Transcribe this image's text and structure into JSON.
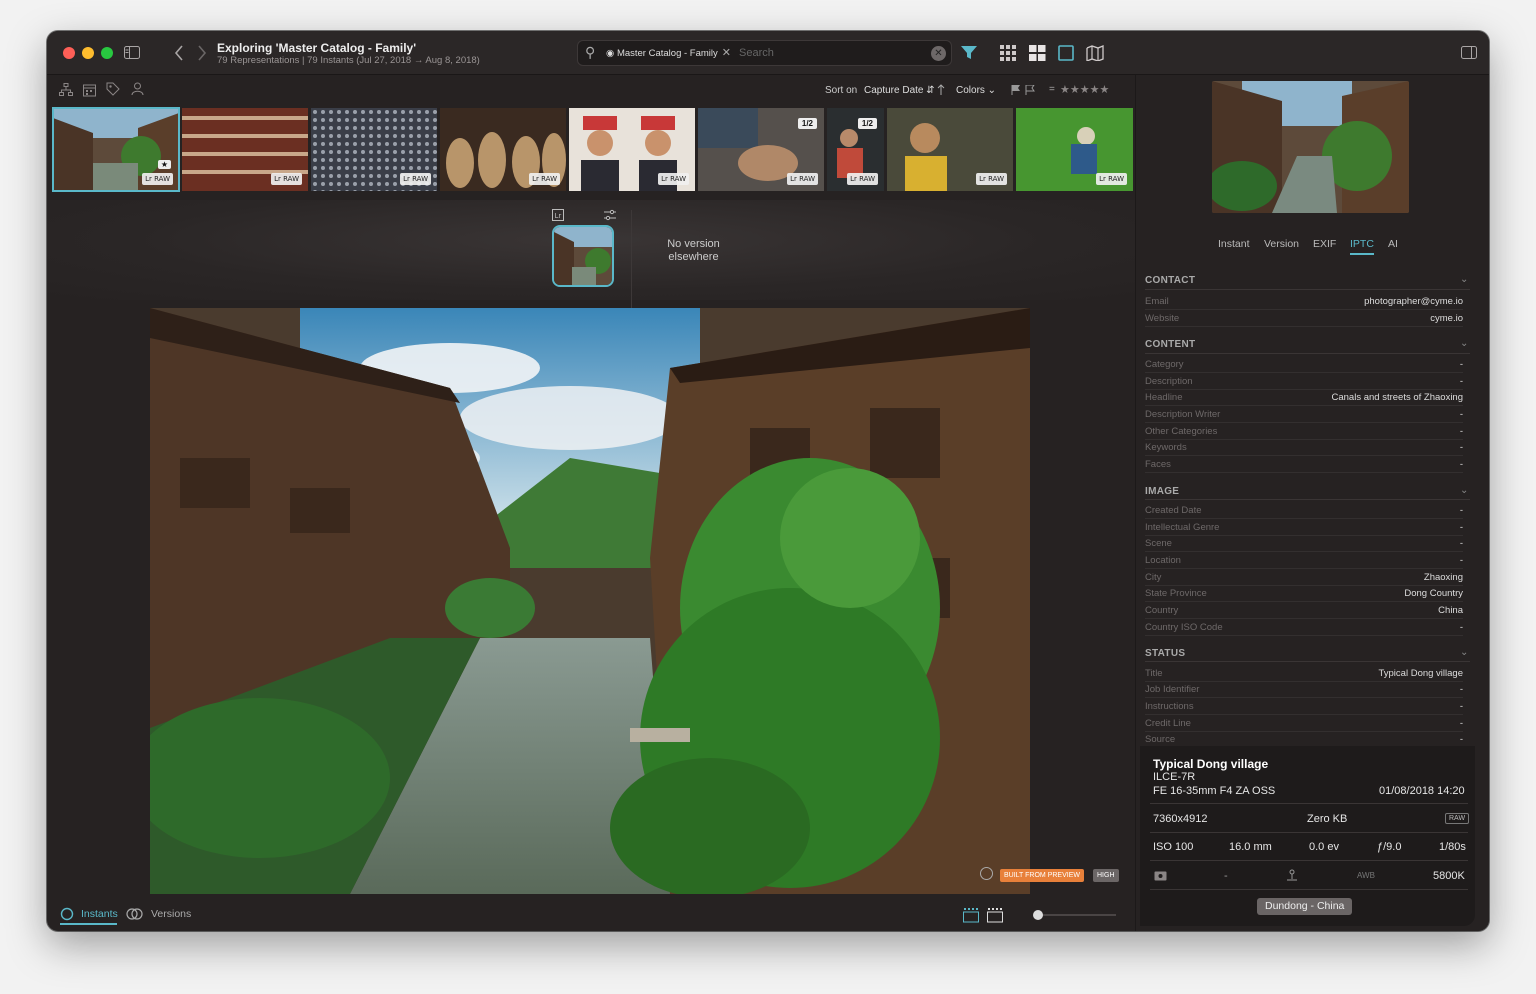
{
  "window": {
    "title": "Exploring 'Master Catalog - Family'",
    "subtitle": "79 Representations | 79 Instants (Jul 27, 2018 → Aug 8, 2018)"
  },
  "search": {
    "chip": "Master Catalog - Family",
    "placeholder": "Search"
  },
  "sort": {
    "label": "Sort on",
    "field": "Capture Date",
    "colors": "Colors",
    "rating": "★★★★★"
  },
  "filmstrip": {
    "badge": "Lr RAW",
    "stack_label": "1/2",
    "star_badge": "★"
  },
  "versions": {
    "no_version": "No version elsewhere"
  },
  "main": {
    "built_label": "BUILT FROM PREVIEW",
    "quality": "HIGH"
  },
  "bottom": {
    "instants": "Instants",
    "versions": "Versions"
  },
  "tabs": [
    "Instant",
    "Version",
    "EXIF",
    "IPTC",
    "AI"
  ],
  "iptc": {
    "contact": {
      "title": "CONTACT",
      "rows": [
        {
          "k": "Email",
          "v": "photographer@cyme.io"
        },
        {
          "k": "Website",
          "v": "cyme.io"
        }
      ]
    },
    "content": {
      "title": "CONTENT",
      "rows": [
        {
          "k": "Category",
          "v": "-"
        },
        {
          "k": "Description",
          "v": "-"
        },
        {
          "k": "Headline",
          "v": "Canals and streets of Zhaoxing"
        },
        {
          "k": "Description Writer",
          "v": "-"
        },
        {
          "k": "Other Categories",
          "v": "-"
        },
        {
          "k": "Keywords",
          "v": "-"
        },
        {
          "k": "Faces",
          "v": "-"
        }
      ]
    },
    "image": {
      "title": "IMAGE",
      "rows": [
        {
          "k": "Created Date",
          "v": "-"
        },
        {
          "k": "Intellectual Genre",
          "v": "-"
        },
        {
          "k": "Scene",
          "v": "-"
        },
        {
          "k": "Location",
          "v": "-"
        },
        {
          "k": "City",
          "v": "Zhaoxing"
        },
        {
          "k": "State Province",
          "v": "Dong Country"
        },
        {
          "k": "Country",
          "v": "China"
        },
        {
          "k": "Country ISO Code",
          "v": "-"
        }
      ]
    },
    "status": {
      "title": "STATUS",
      "rows": [
        {
          "k": "Title",
          "v": "Typical Dong village"
        },
        {
          "k": "Job Identifier",
          "v": "-"
        },
        {
          "k": "Instructions",
          "v": "-"
        },
        {
          "k": "Credit Line",
          "v": "-"
        },
        {
          "k": "Source",
          "v": "-"
        }
      ]
    }
  },
  "card": {
    "title": "Typical Dong village",
    "camera": "ILCE-7R",
    "lens": "FE 16-35mm F4 ZA OSS",
    "date": "01/08/2018 14:20",
    "dimensions": "7360x4912",
    "size": "Zero KB",
    "raw": "RAW",
    "iso": "ISO 100",
    "focal": "16.0 mm",
    "ev": "0.0 ev",
    "aperture": "ƒ/9.0",
    "shutter": "1/80s",
    "dash": "-",
    "awb": "AWB",
    "temp": "5800K",
    "location": "Dundong  -  China"
  },
  "colors": {
    "accent": "#5ab8c9",
    "built": "#e8803a"
  }
}
